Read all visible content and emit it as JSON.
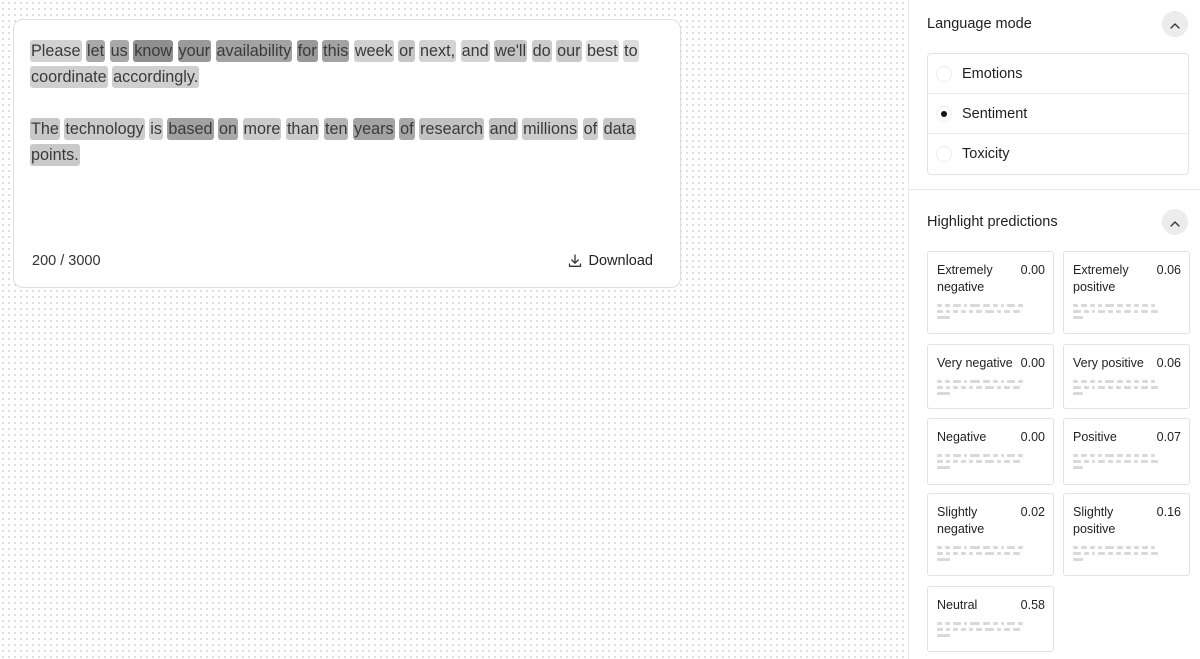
{
  "editor": {
    "paragraphs": [
      [
        {
          "text": "Please",
          "shade": "#d2d2d2"
        },
        {
          "text": " ",
          "shade": ""
        },
        {
          "text": "let",
          "shade": "#a9a9a9"
        },
        {
          "text": " ",
          "shade": ""
        },
        {
          "text": "us",
          "shade": "#a9a9a9"
        },
        {
          "text": " ",
          "shade": ""
        },
        {
          "text": "know",
          "shade": "#8f8f8f"
        },
        {
          "text": " ",
          "shade": ""
        },
        {
          "text": "your",
          "shade": "#9a9a9a"
        },
        {
          "text": " ",
          "shade": ""
        },
        {
          "text": "availability",
          "shade": "#a3a3a3"
        },
        {
          "text": " ",
          "shade": ""
        },
        {
          "text": "for",
          "shade": "#999999"
        },
        {
          "text": " ",
          "shade": ""
        },
        {
          "text": "this",
          "shade": "#a3a3a3"
        },
        {
          "text": " ",
          "shade": ""
        },
        {
          "text": "week",
          "shade": "#d0d0d0"
        },
        {
          "text": " ",
          "shade": ""
        },
        {
          "text": "or",
          "shade": "#c7c7c7"
        },
        {
          "text": " ",
          "shade": ""
        },
        {
          "text": "next,",
          "shade": "#d3d3d3"
        },
        {
          "text": " ",
          "shade": ""
        },
        {
          "text": "and",
          "shade": "#d3d3d3"
        },
        {
          "text": " ",
          "shade": ""
        },
        {
          "text": "we'll",
          "shade": "#c4c4c4"
        },
        {
          "text": " ",
          "shade": ""
        },
        {
          "text": "do",
          "shade": "#cccccc"
        },
        {
          "text": " ",
          "shade": ""
        },
        {
          "text": "our",
          "shade": "#c9c9c9"
        },
        {
          "text": " ",
          "shade": ""
        },
        {
          "text": "best",
          "shade": "#dedede"
        },
        {
          "text": " ",
          "shade": ""
        },
        {
          "text": "to",
          "shade": "#dcdcdc"
        },
        {
          "text": " ",
          "shade": ""
        },
        {
          "text": "coordinate",
          "shade": "#cfcfcf"
        },
        {
          "text": " ",
          "shade": ""
        },
        {
          "text": "accordingly.",
          "shade": "#cfcfcf"
        }
      ],
      [
        {
          "text": "The",
          "shade": "#c8c8c8"
        },
        {
          "text": " ",
          "shade": ""
        },
        {
          "text": "technology",
          "shade": "#cbcbcb"
        },
        {
          "text": " ",
          "shade": ""
        },
        {
          "text": "is",
          "shade": "#cdcdcd"
        },
        {
          "text": " ",
          "shade": ""
        },
        {
          "text": "based",
          "shade": "#a1a1a1"
        },
        {
          "text": " ",
          "shade": ""
        },
        {
          "text": "on",
          "shade": "#a8a8a8"
        },
        {
          "text": " ",
          "shade": ""
        },
        {
          "text": "more",
          "shade": "#cbcbcb"
        },
        {
          "text": " ",
          "shade": ""
        },
        {
          "text": "than",
          "shade": "#cbcbcb"
        },
        {
          "text": " ",
          "shade": ""
        },
        {
          "text": "ten",
          "shade": "#b5b5b5"
        },
        {
          "text": " ",
          "shade": ""
        },
        {
          "text": "years",
          "shade": "#a3a3a3"
        },
        {
          "text": " ",
          "shade": ""
        },
        {
          "text": "of",
          "shade": "#a7a7a7"
        },
        {
          "text": " ",
          "shade": ""
        },
        {
          "text": "research",
          "shade": "#c2c2c2"
        },
        {
          "text": " ",
          "shade": ""
        },
        {
          "text": "and",
          "shade": "#c2c2c2"
        },
        {
          "text": " ",
          "shade": ""
        },
        {
          "text": "millions",
          "shade": "#cccccc"
        },
        {
          "text": " ",
          "shade": ""
        },
        {
          "text": "of",
          "shade": "#cccccc"
        },
        {
          "text": " ",
          "shade": ""
        },
        {
          "text": "data",
          "shade": "#c9c9c9"
        },
        {
          "text": " ",
          "shade": ""
        },
        {
          "text": "points.",
          "shade": "#c9c9c9"
        }
      ]
    ],
    "char_count": "200 / 3000",
    "download_label": "Download"
  },
  "language_mode": {
    "title": "Language mode",
    "options": [
      {
        "label": "Emotions",
        "checked": false
      },
      {
        "label": "Sentiment",
        "checked": true
      },
      {
        "label": "Toxicity",
        "checked": false
      }
    ]
  },
  "highlight_predictions": {
    "title": "Highlight predictions",
    "items": [
      {
        "label": "Extremely negative",
        "value": "0.00"
      },
      {
        "label": "Extremely positive",
        "value": "0.06"
      },
      {
        "label": "Very negative",
        "value": "0.00"
      },
      {
        "label": "Very positive",
        "value": "0.06"
      },
      {
        "label": "Negative",
        "value": "0.00"
      },
      {
        "label": "Positive",
        "value": "0.07"
      },
      {
        "label": "Slightly negative",
        "value": "0.02"
      },
      {
        "label": "Slightly positive",
        "value": "0.16"
      },
      {
        "label": "Neutral",
        "value": "0.58"
      }
    ]
  }
}
